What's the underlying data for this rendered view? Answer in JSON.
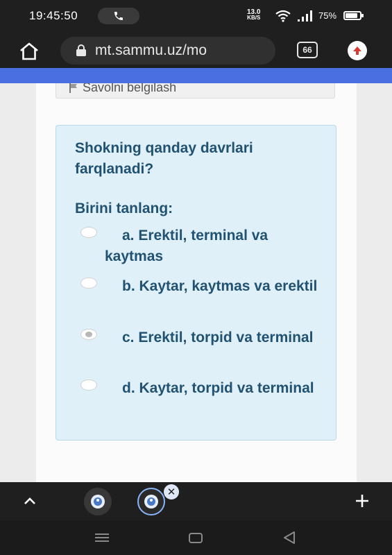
{
  "status_bar": {
    "time": "19:45:50",
    "speed_value": "13.0",
    "speed_unit": "KB/S",
    "battery_text": "75%",
    "battery_level": 0.75,
    "call_icon": "phone-icon"
  },
  "browser": {
    "url": "mt.sammu.uz/mo",
    "tab_count": "66",
    "home_icon": "home-icon",
    "lock_icon": "lock-icon",
    "update_icon": "update-arrow-icon"
  },
  "page": {
    "flag_label": "Savolni belgilash",
    "question": "Shokning qanday davrlari farqlanadi?",
    "prompt": "Birini tanlang:",
    "answers": [
      {
        "text": "a. Erektil, terminal va kaytmas",
        "selected": false
      },
      {
        "text": "b. Kaytar, kaytmas va erektil",
        "selected": false
      },
      {
        "text": "c. Erektil, torpid va terminal",
        "selected": true
      },
      {
        "text": "d. Kaytar, torpid va terminal",
        "selected": false
      }
    ]
  },
  "toolbar": {
    "close_label": "✕",
    "plus_label": "+"
  },
  "colors": {
    "accent": "#4a6fe0",
    "question_bg": "#dff0f8",
    "question_text": "#225272"
  }
}
